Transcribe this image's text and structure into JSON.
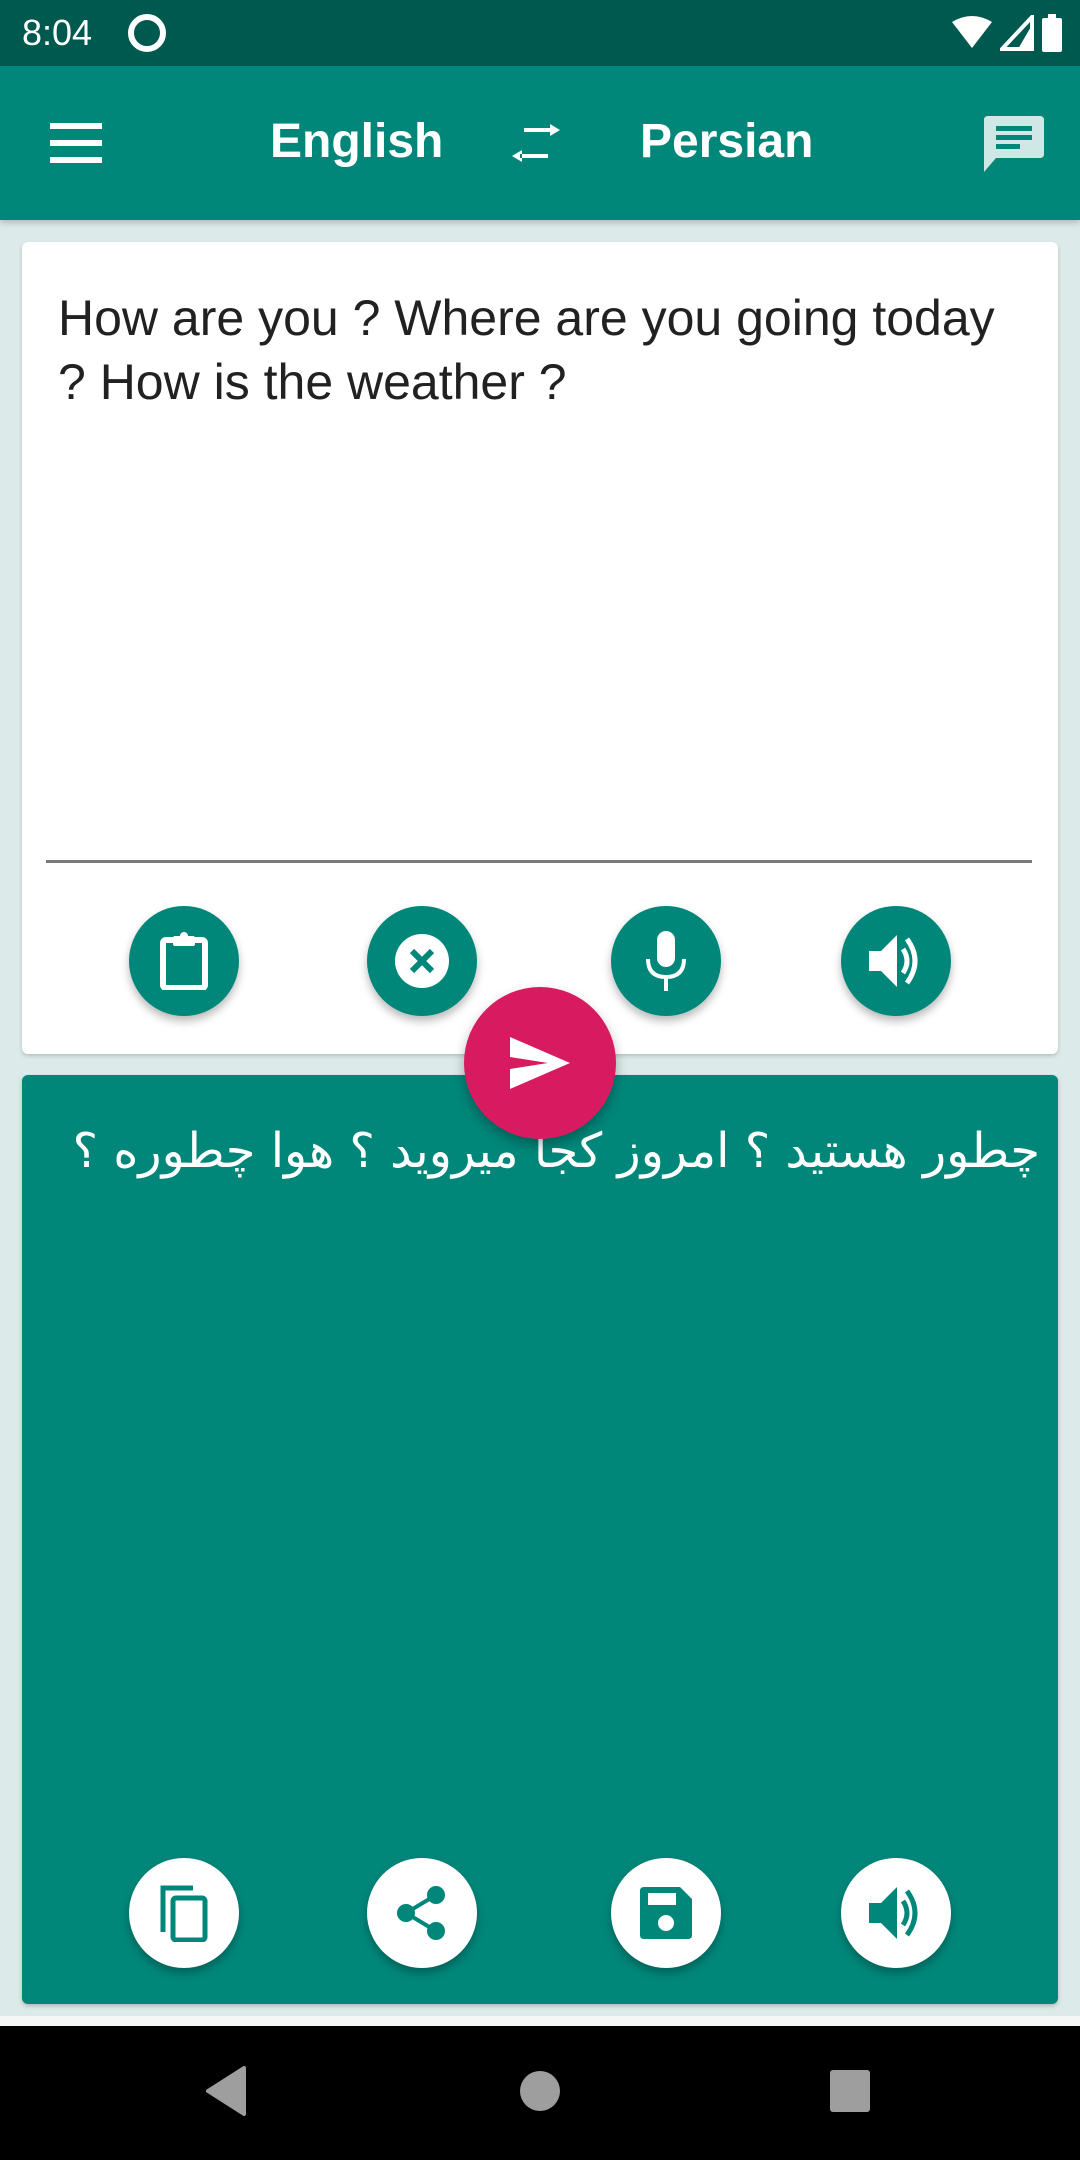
{
  "status_bar": {
    "time": "8:04",
    "icons": [
      "assistant-icon",
      "wifi-icon",
      "signal-icon",
      "battery-icon"
    ]
  },
  "app_bar": {
    "menu_icon": "menu-icon",
    "source_language": "English",
    "swap_icon": "swap-horiz-icon",
    "target_language": "Persian",
    "conversation_icon": "chat-icon"
  },
  "input": {
    "text": "How are you ? Where are you going today ? How is the weather ?",
    "actions": [
      {
        "name": "paste-button",
        "icon": "clipboard-icon"
      },
      {
        "name": "clear-button",
        "icon": "cancel-icon"
      },
      {
        "name": "voice-input-button",
        "icon": "microphone-icon"
      },
      {
        "name": "speak-input-button",
        "icon": "volume-icon"
      }
    ]
  },
  "translate_button": {
    "icon": "send-icon"
  },
  "output": {
    "text": "چطور هستید ؟ امروز کجا میروید ؟ هوا چطوره ؟",
    "actions": [
      {
        "name": "copy-button",
        "icon": "copy-icon"
      },
      {
        "name": "share-button",
        "icon": "share-icon"
      },
      {
        "name": "save-button",
        "icon": "save-icon"
      },
      {
        "name": "speak-output-button",
        "icon": "volume-icon"
      }
    ]
  },
  "colors": {
    "primary": "#00877a",
    "primary_dark": "#00594f",
    "accent": "#d81b60",
    "background": "#dcebe9"
  },
  "nav_bar": {
    "buttons": [
      "back",
      "home",
      "recents"
    ]
  }
}
